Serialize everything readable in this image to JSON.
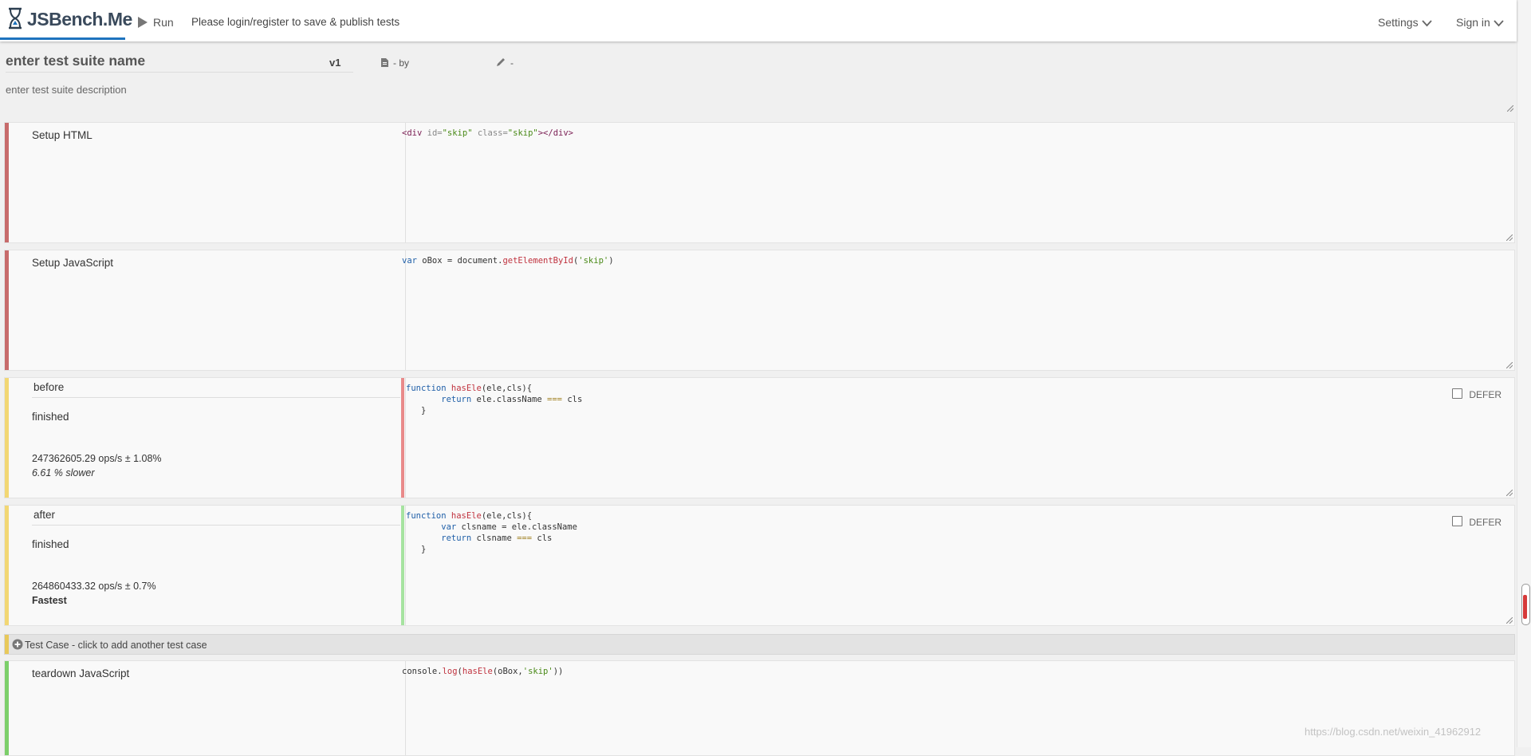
{
  "header": {
    "logo_text": "JSBench.Me",
    "run_label": "Run",
    "login_message": "Please login/register to save & publish tests",
    "settings_label": "Settings",
    "signin_label": "Sign in"
  },
  "suite": {
    "name": "enter test suite name",
    "version": "v1",
    "by_text": "- by",
    "edit_text": "-",
    "description": "enter test suite description"
  },
  "setup_html": {
    "title": "Setup HTML"
  },
  "setup_js": {
    "title": "Setup JavaScript"
  },
  "test_cases": [
    {
      "name": "before",
      "status": "finished",
      "ops": "247362605.29 ops/s ± 1.08%",
      "comparison": "6.61 % slower",
      "defer_label": "DEFER"
    },
    {
      "name": "after",
      "status": "finished",
      "ops": "264860433.32 ops/s ± 0.7%",
      "comparison": "Fastest",
      "defer_label": "DEFER"
    }
  ],
  "add_test_case_label": "Test Case - click to add another test case",
  "teardown_js": {
    "title": "teardown JavaScript"
  },
  "watermark": "https://blog.csdn.net/weixin_41962912",
  "colors": {
    "setup_bar": "#c76b6b",
    "testcase_bar": "#f2d774",
    "teardown_bar": "#7ccf6a",
    "code_bar_slow": "#e98a8a",
    "code_bar_fast": "#a6e3a0",
    "accent": "#1e73be"
  }
}
